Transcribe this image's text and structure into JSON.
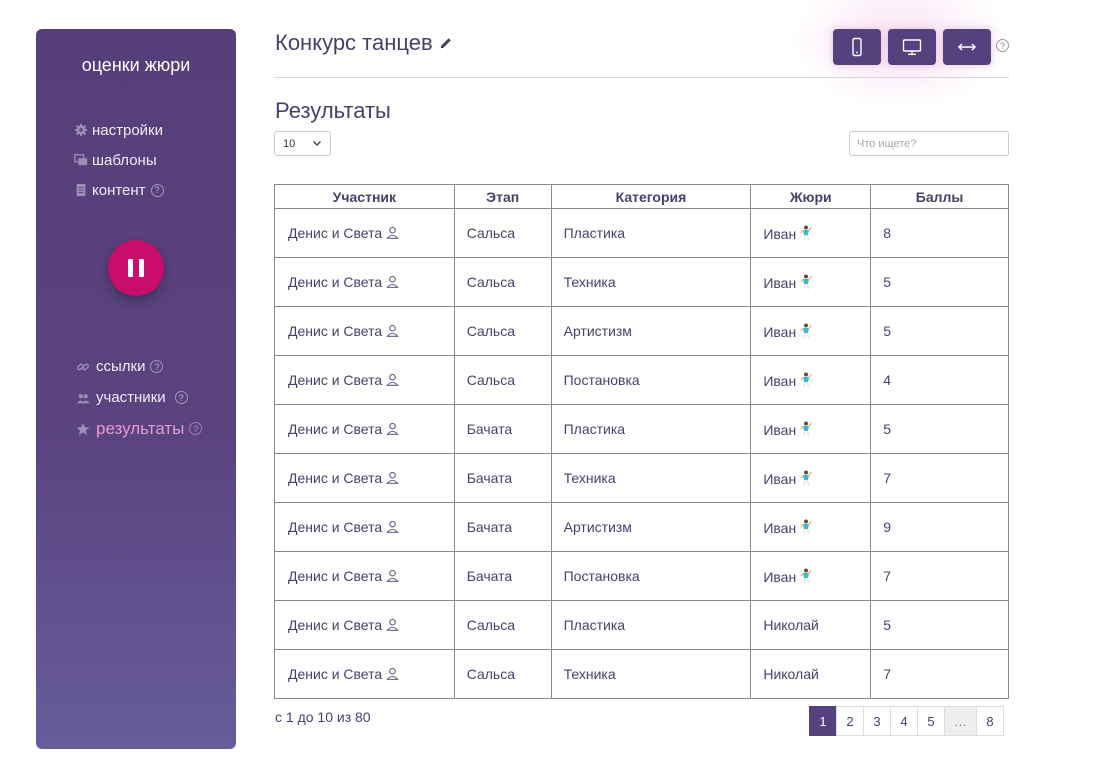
{
  "sidebar": {
    "title": "оценки жюри",
    "top_items": [
      {
        "label": "настройки",
        "icon": "gear-icon"
      },
      {
        "label": "шаблоны",
        "icon": "templates-icon"
      },
      {
        "label": "контент",
        "icon": "document-icon"
      }
    ],
    "bottom_items": [
      {
        "label": "ссылки",
        "icon": "link-icon"
      },
      {
        "label": "участники",
        "icon": "users-icon"
      },
      {
        "label": "результаты",
        "icon": "star-icon",
        "active": true
      }
    ],
    "help_mark": "?"
  },
  "header": {
    "title": "Конкурс танцев",
    "help_mark": "?"
  },
  "results": {
    "title": "Результаты",
    "page_size": "10",
    "search_placeholder": "Что ищете?",
    "columns": [
      "Участник",
      "Этап",
      "Категория",
      "Жюри",
      "Баллы"
    ],
    "rows": [
      {
        "participant": "Денис и Света",
        "stage": "Сальса",
        "category": "Пластика",
        "judge": "Иван",
        "judge_icon": true,
        "score": "8"
      },
      {
        "participant": "Денис и Света",
        "stage": "Сальса",
        "category": "Техника",
        "judge": "Иван",
        "judge_icon": true,
        "score": "5"
      },
      {
        "participant": "Денис и Света",
        "stage": "Сальса",
        "category": "Артистизм",
        "judge": "Иван",
        "judge_icon": true,
        "score": "5"
      },
      {
        "participant": "Денис и Света",
        "stage": "Сальса",
        "category": "Постановка",
        "judge": "Иван",
        "judge_icon": true,
        "score": "4"
      },
      {
        "participant": "Денис и Света",
        "stage": "Бачата",
        "category": "Пластика",
        "judge": "Иван",
        "judge_icon": true,
        "score": "5"
      },
      {
        "participant": "Денис и Света",
        "stage": "Бачата",
        "category": "Техника",
        "judge": "Иван",
        "judge_icon": true,
        "score": "7"
      },
      {
        "participant": "Денис и Света",
        "stage": "Бачата",
        "category": "Артистизм",
        "judge": "Иван",
        "judge_icon": true,
        "score": "9"
      },
      {
        "participant": "Денис и Света",
        "stage": "Бачата",
        "category": "Постановка",
        "judge": "Иван",
        "judge_icon": true,
        "score": "7"
      },
      {
        "participant": "Денис и Света",
        "stage": "Сальса",
        "category": "Пластика",
        "judge": "Николай",
        "judge_icon": false,
        "score": "5"
      },
      {
        "participant": "Денис и Света",
        "stage": "Сальса",
        "category": "Техника",
        "judge": "Николай",
        "judge_icon": false,
        "score": "7"
      }
    ],
    "summary": "с 1 до 10 из 80",
    "pages": [
      "1",
      "2",
      "3",
      "4",
      "5",
      "…",
      "8"
    ],
    "current_page": "1"
  },
  "colors": {
    "sidebar": "#563e79",
    "accent": "#54417d",
    "pause": "#c80d6b",
    "active_link": "#e79ad0"
  }
}
